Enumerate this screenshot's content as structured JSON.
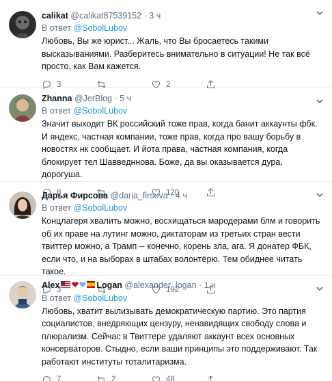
{
  "tweets": [
    {
      "name": "calikat",
      "handle": "@calikat87539152",
      "dot": "·",
      "time": "3 ч",
      "reply_prefix": "В ответ",
      "reply_mention": "@SobolLubov",
      "text": "Любовь, Вы же юрист... Жаль, что Вы бросаетесь такими высказываниями.  Разберитесь внимательно в ситуации! Не так всё просто, как Вам кажется.",
      "counts": {
        "reply": "3",
        "retweet": "",
        "like": "2",
        "share": ""
      }
    },
    {
      "name": "Zhanna",
      "handle": "@JerBlog",
      "dot": "·",
      "time": "5 ч",
      "reply_prefix": "В ответ",
      "reply_mention": "@SobolLubov",
      "text": "Значит выходит ВК российский тоже прав, когда банит аккаунты фбк. И яндекс, частная компании, тоже прав, когда про вашу борьбу в новостях нк сообщает. И йота права, частная компания, когда блокирует тел Шавведннова. Боже, да вы оказывается дура, дорогуша.",
      "counts": {
        "reply": "8",
        "retweet": "",
        "like": "120",
        "share": ""
      }
    },
    {
      "name": "Дарья Фирсова",
      "handle": "@daria_firsova",
      "dot": "·",
      "time": "4 ч",
      "reply_prefix": "В ответ",
      "reply_mention": "@SobolLubov",
      "text": "Концлагеря хвалить можно, восхищаться мародерами блм и говорить об их праве на лутинг можно, диктаторам из третьих стран вести твиттер можно, а Трамп -- конечно, корень зла, ага. Я донатер ФБК, если что, и на выборах в штабах волонтёрю. Тем обиднее читать такое.",
      "counts": {
        "reply": "3",
        "retweet": "",
        "like": "102",
        "share": ""
      }
    },
    {
      "name_part1": "Alex",
      "name_part2": "Logan",
      "handle": "@alexander_logan",
      "dot": "·",
      "time": "1 ч",
      "reply_prefix": "В ответ",
      "reply_mention": "@SobolLubov",
      "text": "Любовь, хватит вылизывать демократическую партию. Это партия социалистов, внедряющих цензуру, ненавидящих свободу слова и плюрализм. Сейчас в Твиттере удаляют аккаунт всех основных консерваторов. Стыдно, если ваши принципы это поддерживают. Так работают институты тоталитаризма.",
      "counts": {
        "reply": "7",
        "retweet": "2",
        "like": "48",
        "share": ""
      }
    }
  ],
  "colors": {
    "accent": "#1b95e0",
    "muted": "#5b7083",
    "divider": "#e6ecf0",
    "text": "#0f1419"
  },
  "icons": {
    "reply": "reply-icon",
    "retweet": "retweet-icon",
    "like": "like-icon",
    "share": "share-icon",
    "more": "chevron-down-icon"
  }
}
